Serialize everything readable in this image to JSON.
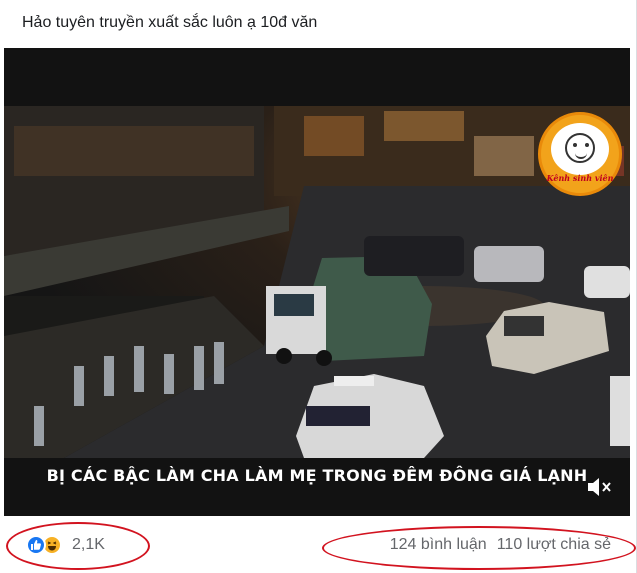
{
  "post": {
    "caption": "Hảo tuyên truyền xuất sắc luôn ạ 10đ văn"
  },
  "video": {
    "logo_text": "Kênh sinh viên",
    "subtitle": "BỊ CÁC BẬC LÀM CHA LÀM MẸ TRONG ĐÊM ĐÔNG GIÁ LẠNH",
    "watermark": "KÊNH SINH VIÊN",
    "icons": {
      "mute": "speaker-muted-icon",
      "logo": "kenh-sinh-vien-logo"
    }
  },
  "footer": {
    "reaction_icons": [
      "like-icon",
      "haha-icon"
    ],
    "reaction_count": "2,1K",
    "comments": "124 bình luận",
    "shares": "110 lượt chia sẻ"
  },
  "colors": {
    "annotation": "#d2131f",
    "like": "#1877f2",
    "haha": "#f7b125",
    "logo": "#f2a31b"
  }
}
